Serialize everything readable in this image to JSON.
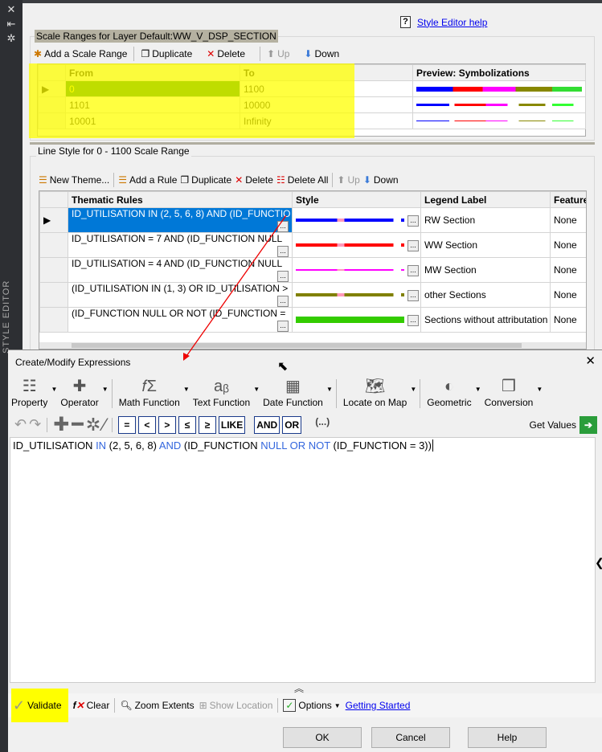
{
  "sidebar": {
    "title": "STYLE EDITOR",
    "icons": [
      "close-icon",
      "pin-icon",
      "settings-icon"
    ]
  },
  "help": {
    "icon": "?",
    "label": "Style Editor help"
  },
  "scale_ranges": {
    "title": "Scale Ranges for Layer Default:WW_V_DSP_SECTION",
    "toolbar": {
      "add": "Add a Scale Range",
      "duplicate": "Duplicate",
      "delete": "Delete",
      "up": "Up",
      "down": "Down"
    },
    "columns": [
      "From",
      "To",
      "Preview: Symbolizations"
    ],
    "rows": [
      {
        "from": "0",
        "to": "1100"
      },
      {
        "from": "1101",
        "to": "10000"
      },
      {
        "from": "10001",
        "to": "Infinity"
      }
    ]
  },
  "line_style": {
    "title": "Line Style for 0 - 1100 Scale Range",
    "toolbar": {
      "new_theme": "New Theme...",
      "add_rule": "Add a Rule",
      "duplicate": "Duplicate",
      "delete": "Delete",
      "delete_all": "Delete All",
      "up": "Up",
      "down": "Down"
    },
    "columns": [
      "Thematic Rules",
      "Style",
      "Legend Label",
      "Feature"
    ],
    "rows": [
      {
        "rule": "ID_UTILISATION IN (2, 5, 6, 8) AND (ID_FUNCTIO",
        "legend": "RW Section",
        "feature": "None",
        "color": "#0000ff"
      },
      {
        "rule": "ID_UTILISATION = 7 AND (ID_FUNCTION NULL",
        "legend": "WW Section",
        "feature": "None",
        "color": "#ff0000"
      },
      {
        "rule": "ID_UTILISATION  = 4 AND (ID_FUNCTION NULL",
        "legend": "MW Section",
        "feature": "None",
        "color": "#ff00ff"
      },
      {
        "rule": "(ID_UTILISATION IN (1, 3) OR  ID_UTILISATION >",
        "legend": "other Sections",
        "feature": "None",
        "color": "#808000"
      },
      {
        "rule": "(ID_FUNCTION NULL OR NOT (ID_FUNCTION =",
        "legend": "Sections without attributation",
        "feature": "None",
        "color": "#33cc00"
      }
    ]
  },
  "dialog": {
    "title": "Create/Modify Expressions",
    "close": "✕",
    "toolbar": [
      "Property",
      "Operator",
      "Math Function",
      "Text Function",
      "Date Function",
      "Locate on Map",
      "Geometric",
      "Conversion"
    ],
    "operators": [
      "=",
      "<",
      ">",
      "≤",
      "≥",
      "LIKE",
      "AND",
      "OR",
      "(...)"
    ],
    "get_values": "Get Values",
    "expression": {
      "p1": "ID_UTILISATION ",
      "k1": "IN",
      "p2": " (2, 5, 6, 8) ",
      "k2": "AND",
      "p3": " (ID_FUNCTION ",
      "k3": "NULL OR NOT",
      "p4": " (ID_FUNCTION = 3))"
    },
    "bottom": {
      "validate": "Validate",
      "clear": "Clear",
      "zoom_extents": "Zoom Extents",
      "show_location": "Show Location",
      "options": "Options",
      "getting_started": "Getting Started"
    },
    "buttons": {
      "ok": "OK",
      "cancel": "Cancel",
      "help": "Help"
    }
  }
}
